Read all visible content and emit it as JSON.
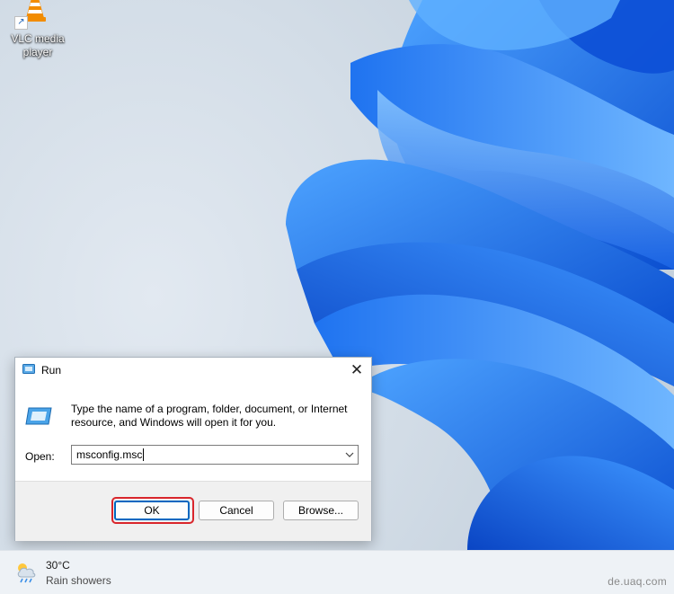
{
  "desktop": {
    "icons": [
      {
        "label": "VLC media player",
        "icon": "vlc-icon"
      }
    ]
  },
  "run_dialog": {
    "title": "Run",
    "description": "Type the name of a program, folder, document, or Internet resource, and Windows will open it for you.",
    "open_label": "Open:",
    "open_value": "msconfig.msc",
    "buttons": {
      "ok": "OK",
      "cancel": "Cancel",
      "browse": "Browse..."
    },
    "highlighted_button": "ok",
    "highlight_color": "#d9262c"
  },
  "taskbar": {
    "weather": {
      "temperature": "30°C",
      "condition": "Rain showers",
      "icon": "rain-showers-icon"
    }
  },
  "watermark": "de.uaq.com",
  "colors": {
    "wallpaper_accent": "#1a6fe6",
    "focus_border": "#0067c0"
  }
}
